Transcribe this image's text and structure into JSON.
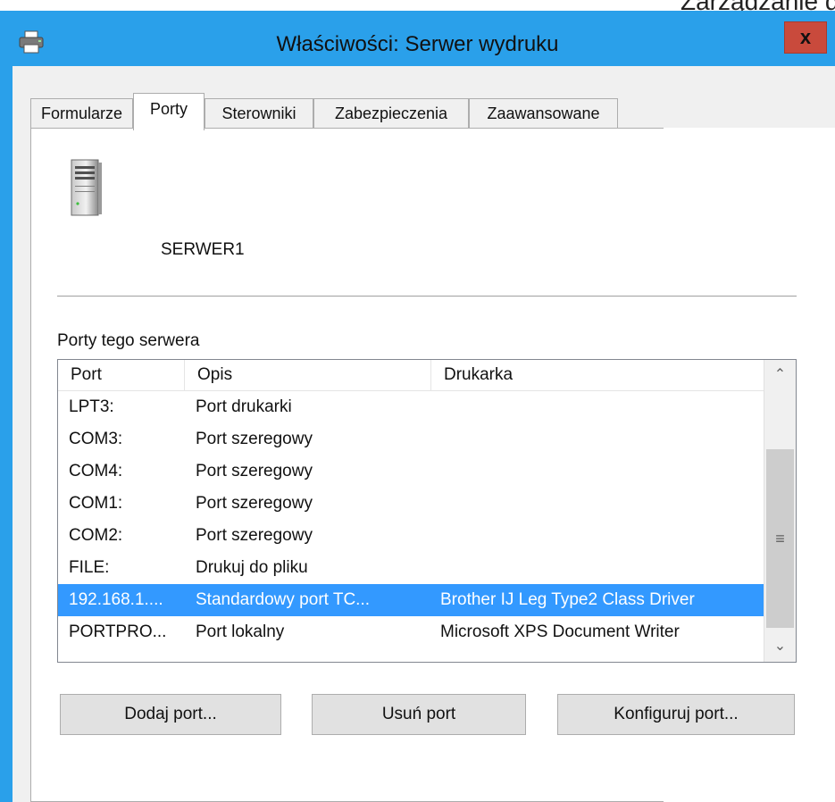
{
  "background_text": "Zarządzanie d",
  "window": {
    "title": "Właściwości: Serwer wydruku",
    "close_label": "x"
  },
  "tabs": [
    {
      "label": "Formularze",
      "active": false
    },
    {
      "label": "Porty",
      "active": true
    },
    {
      "label": "Sterowniki",
      "active": false
    },
    {
      "label": "Zabezpieczenia",
      "active": false
    },
    {
      "label": "Zaawansowane",
      "active": false
    }
  ],
  "server": {
    "name": "SERWER1",
    "icon": "server-icon"
  },
  "ports_section": {
    "label": "Porty tego serwera",
    "columns": [
      "Port",
      "Opis",
      "Drukarka"
    ],
    "rows": [
      {
        "port": "LPT3:",
        "desc": "Port drukarki",
        "printer": "",
        "selected": false
      },
      {
        "port": "COM3:",
        "desc": "Port szeregowy",
        "printer": "",
        "selected": false
      },
      {
        "port": "COM4:",
        "desc": "Port szeregowy",
        "printer": "",
        "selected": false
      },
      {
        "port": "COM1:",
        "desc": "Port szeregowy",
        "printer": "",
        "selected": false
      },
      {
        "port": "COM2:",
        "desc": "Port szeregowy",
        "printer": "",
        "selected": false
      },
      {
        "port": "FILE:",
        "desc": "Drukuj do pliku",
        "printer": "",
        "selected": false
      },
      {
        "port": "192.168.1....",
        "desc": "Standardowy port TC...",
        "printer": "Brother IJ Leg Type2 Class Driver",
        "selected": true
      },
      {
        "port": "PORTPRO...",
        "desc": "Port lokalny",
        "printer": "Microsoft XPS Document Writer",
        "selected": false
      }
    ]
  },
  "buttons": {
    "add_port": "Dodaj port...",
    "remove_port": "Usuń port",
    "configure_port": "Konfiguruj port..."
  },
  "colors": {
    "window_frame": "#2aa0ea",
    "selection": "#3399ff",
    "close_button": "#c94a3c"
  }
}
